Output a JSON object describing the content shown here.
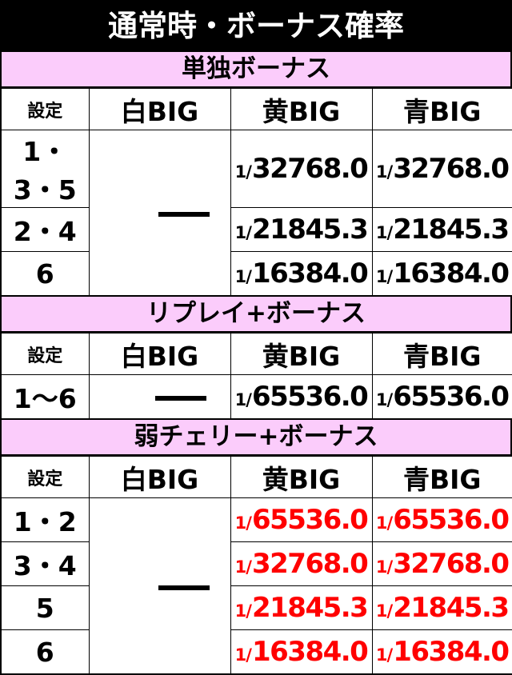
{
  "header": {
    "title": "通常時・ボーナス確率"
  },
  "columns": {
    "setting": "設定",
    "white_big": "白BIG",
    "yellow_big": "黄BIG",
    "blue_big": "青BIG"
  },
  "dash": "—",
  "colors": {
    "title_bg": "#000000",
    "title_text": "#ffffff",
    "section_band_bg": "#fbccfb",
    "setting_header_bg": "#d0d0d0",
    "big_header_bg": "#c4c4f6",
    "value_black": "#000000",
    "value_red": "#ff0000",
    "border": "#000000"
  },
  "sections": [
    {
      "band_label": "単独ボーナス",
      "value_color": "black",
      "white_big": "—",
      "rows": [
        {
          "setting": "1・3・5",
          "yellow_big": {
            "frac": "1/",
            "num": "32768.0"
          },
          "blue_big": {
            "frac": "1/",
            "num": "32768.0"
          }
        },
        {
          "setting": "2・4",
          "yellow_big": {
            "frac": "1/",
            "num": "21845.3"
          },
          "blue_big": {
            "frac": "1/",
            "num": "21845.3"
          }
        },
        {
          "setting": "6",
          "yellow_big": {
            "frac": "1/",
            "num": "16384.0"
          },
          "blue_big": {
            "frac": "1/",
            "num": "16384.0"
          }
        }
      ]
    },
    {
      "band_label": "リプレイ+ボーナス",
      "value_color": "black",
      "white_big": "—",
      "rows": [
        {
          "setting": "1〜6",
          "yellow_big": {
            "frac": "1/",
            "num": "65536.0"
          },
          "blue_big": {
            "frac": "1/",
            "num": "65536.0"
          }
        }
      ]
    },
    {
      "band_label": "弱チェリー+ボーナス",
      "value_color": "red",
      "white_big": "—",
      "rows": [
        {
          "setting": "1・2",
          "yellow_big": {
            "frac": "1/",
            "num": "65536.0"
          },
          "blue_big": {
            "frac": "1/",
            "num": "65536.0"
          }
        },
        {
          "setting": "3・4",
          "yellow_big": {
            "frac": "1/",
            "num": "32768.0"
          },
          "blue_big": {
            "frac": "1/",
            "num": "32768.0"
          }
        },
        {
          "setting": "5",
          "yellow_big": {
            "frac": "1/",
            "num": "21845.3"
          },
          "blue_big": {
            "frac": "1/",
            "num": "21845.3"
          }
        },
        {
          "setting": "6",
          "yellow_big": {
            "frac": "1/",
            "num": "16384.0"
          },
          "blue_big": {
            "frac": "1/",
            "num": "16384.0"
          }
        }
      ]
    }
  ]
}
